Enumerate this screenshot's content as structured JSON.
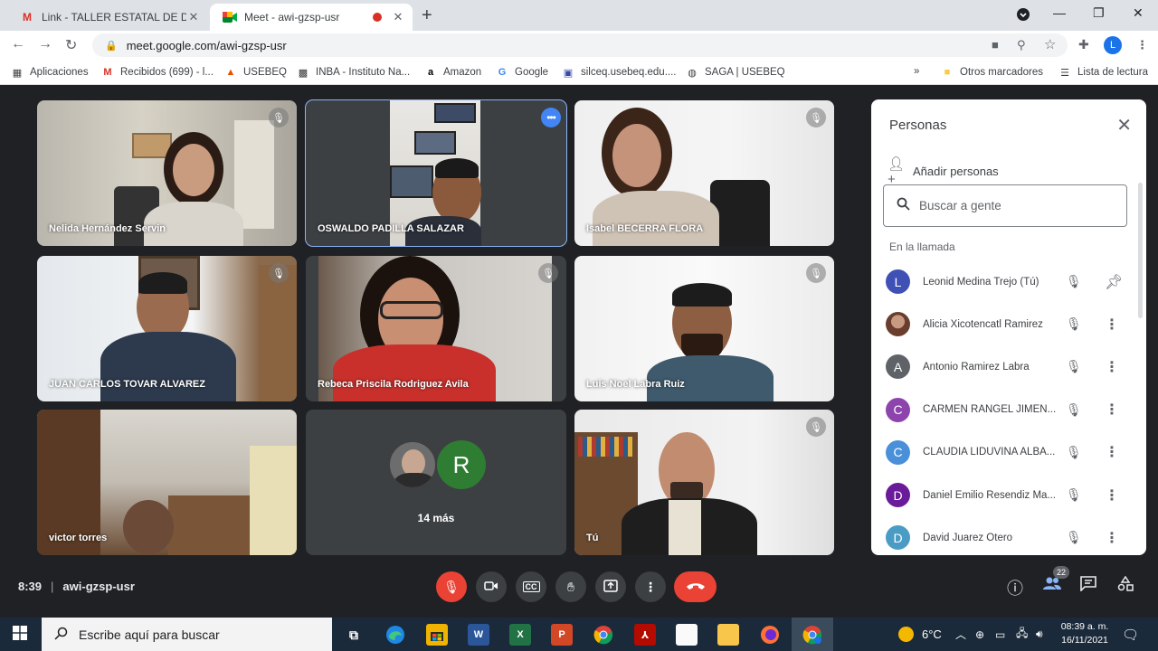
{
  "browser": {
    "tabs": [
      {
        "title": "Link - TALLER ESTATAL DE DIRECT",
        "favicon": "gmail-icon"
      },
      {
        "title": "Meet - awi-gzsp-usr",
        "favicon": "meet-icon",
        "recording": true
      }
    ],
    "url": "meet.google.com/awi-gzsp-usr",
    "profile_initial": "L",
    "bookmarks": [
      {
        "label": "Aplicaciones",
        "icon": "apps-grid-icon"
      },
      {
        "label": "Recibidos (699) - l...",
        "icon": "gmail-icon"
      },
      {
        "label": "USEBEQ",
        "icon": "usebeq-icon"
      },
      {
        "label": "INBA - Instituto Na...",
        "icon": "inba-icon"
      },
      {
        "label": "Amazon",
        "icon": "amazon-icon"
      },
      {
        "label": "Google",
        "icon": "google-icon"
      },
      {
        "label": "silceq.usebeq.edu....",
        "icon": "silceq-icon"
      },
      {
        "label": "SAGA | USEBEQ",
        "icon": "globe-icon"
      }
    ],
    "bookmarks_overflow": "»",
    "other_bookmarks": "Otros marcadores",
    "reading_list": "Lista de lectura"
  },
  "tiles": [
    {
      "name": "Nelida Hernández Servin",
      "muted": true
    },
    {
      "name": "OSWALDO PADILLA SALAZAR",
      "muted": false,
      "speaking": true
    },
    {
      "name": "Isabel BECERRA FLORA",
      "muted": true
    },
    {
      "name": "JUAN CARLOS TOVAR ALVAREZ",
      "muted": true
    },
    {
      "name": "Rebeca Priscila Rodriguez Avila",
      "muted": true
    },
    {
      "name": "Luis Noel Labra Ruiz",
      "muted": true
    },
    {
      "name": "victor torres",
      "muted": false
    },
    {
      "name": "",
      "more_count": "14 más",
      "avatar_letter": "R"
    },
    {
      "name": "Tú",
      "muted": true
    }
  ],
  "people_panel": {
    "title": "Personas",
    "add_people": "Añadir personas",
    "search_placeholder": "Buscar a gente",
    "section": "En la llamada",
    "people": [
      {
        "name": "Leonid Medina Trejo (Tú)",
        "initial": "L",
        "color": "#3f51b5",
        "action": "pin-icon"
      },
      {
        "name": "Alicia Xicotencatl Ramirez",
        "initial": "",
        "color": "#b0826a",
        "action": "more-vert-icon"
      },
      {
        "name": "Antonio Ramirez Labra",
        "initial": "A",
        "color": "#5f6368",
        "action": "more-vert-icon"
      },
      {
        "name": "CARMEN RANGEL JIMEN...",
        "initial": "C",
        "color": "#8e44ad",
        "action": "more-vert-icon"
      },
      {
        "name": "CLAUDIA LIDUVINA ALBA...",
        "initial": "C",
        "color": "#4a90d9",
        "action": "more-vert-icon"
      },
      {
        "name": "Daniel Emilio Resendiz Ma...",
        "initial": "D",
        "color": "#6a1b9a",
        "action": "more-vert-icon"
      },
      {
        "name": "David Juarez Otero",
        "initial": "D",
        "color": "#4a9cc4",
        "action": "more-vert-icon"
      }
    ]
  },
  "controls": {
    "time": "8:39",
    "meeting_code": "awi-gzsp-usr",
    "participant_count": "22"
  },
  "taskbar": {
    "search_placeholder": "Escribe aquí para buscar",
    "temperature": "6°C",
    "time": "08:39 a. m.",
    "date": "16/11/2021"
  }
}
